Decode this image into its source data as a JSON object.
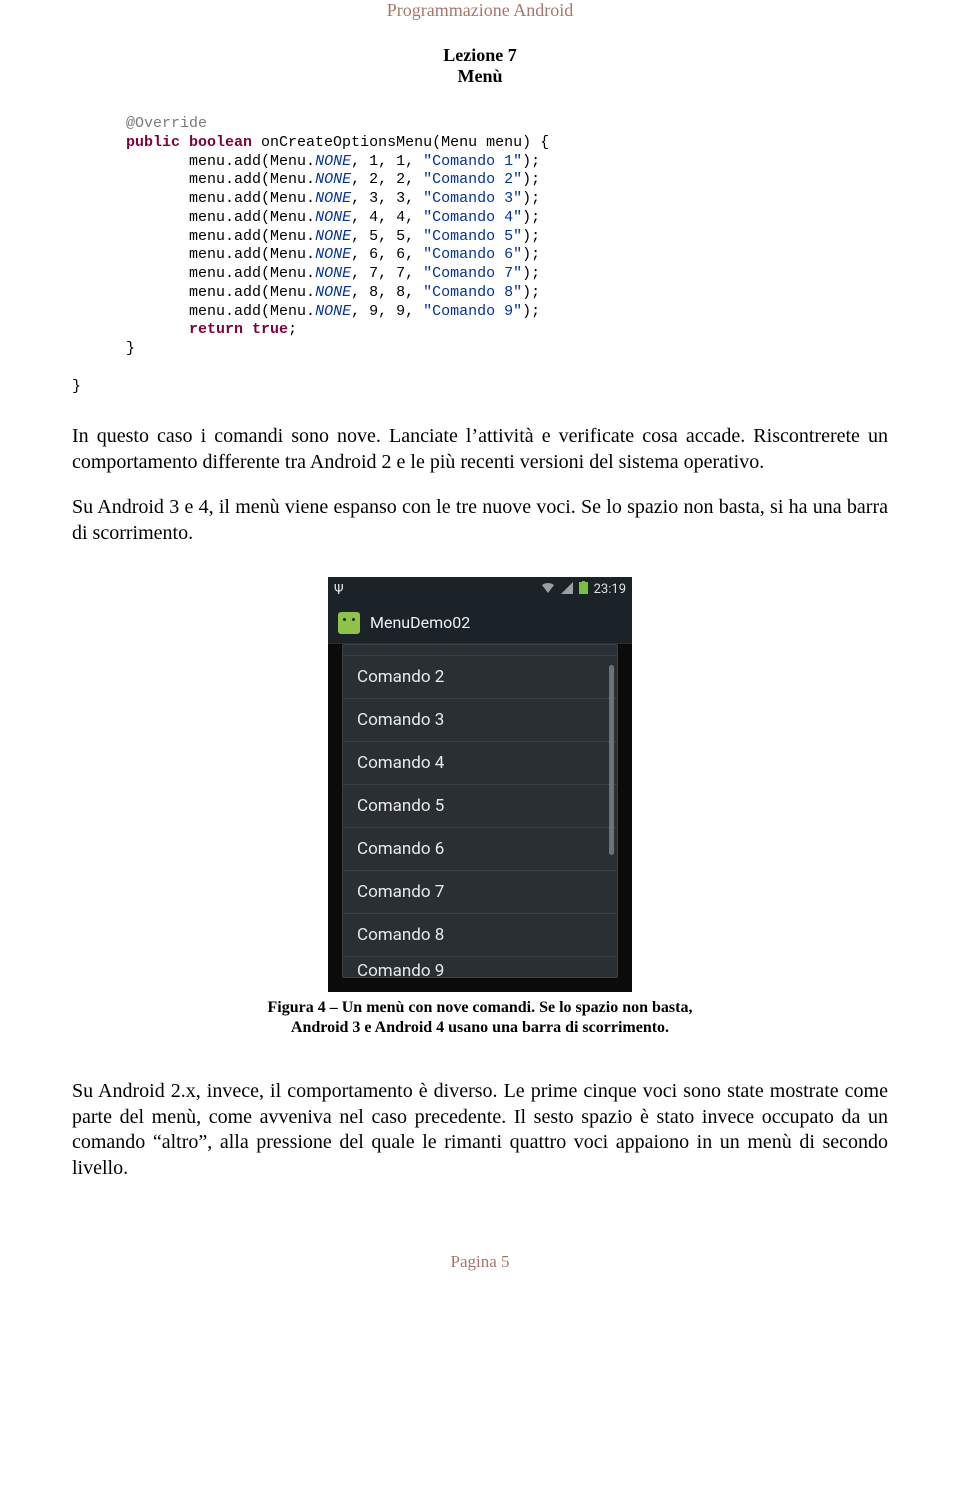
{
  "header": {
    "course": "Programmazione Android",
    "lesson": "Lezione 7",
    "topic": "Menù"
  },
  "code": {
    "annotation": "@Override",
    "signature_prefix": "public boolean",
    "signature_rest": " onCreateOptionsMenu(Menu menu) {",
    "lines": [
      {
        "prefix": "menu.add(Menu.",
        "field": "NONE",
        "mid": ", 1, 1, ",
        "str": "\"Comando 1\"",
        "suffix": ");"
      },
      {
        "prefix": "menu.add(Menu.",
        "field": "NONE",
        "mid": ", 2, 2, ",
        "str": "\"Comando 2\"",
        "suffix": ");"
      },
      {
        "prefix": "menu.add(Menu.",
        "field": "NONE",
        "mid": ", 3, 3, ",
        "str": "\"Comando 3\"",
        "suffix": ");"
      },
      {
        "prefix": "menu.add(Menu.",
        "field": "NONE",
        "mid": ", 4, 4, ",
        "str": "\"Comando 4\"",
        "suffix": ");"
      },
      {
        "prefix": "menu.add(Menu.",
        "field": "NONE",
        "mid": ", 5, 5, ",
        "str": "\"Comando 5\"",
        "suffix": ");"
      },
      {
        "prefix": "menu.add(Menu.",
        "field": "NONE",
        "mid": ", 6, 6, ",
        "str": "\"Comando 6\"",
        "suffix": ");"
      },
      {
        "prefix": "menu.add(Menu.",
        "field": "NONE",
        "mid": ", 7, 7, ",
        "str": "\"Comando 7\"",
        "suffix": ");"
      },
      {
        "prefix": "menu.add(Menu.",
        "field": "NONE",
        "mid": ", 8, 8, ",
        "str": "\"Comando 8\"",
        "suffix": ");"
      },
      {
        "prefix": "menu.add(Menu.",
        "field": "NONE",
        "mid": ", 9, 9, ",
        "str": "\"Comando 9\"",
        "suffix": ");"
      }
    ],
    "ret_kw": "return true",
    "ret_suffix": ";",
    "close1": "}",
    "close2": "}"
  },
  "paragraphs": {
    "p1": "In questo caso i comandi sono nove. Lanciate l’attività e verificate cosa accade. Riscontrerete un comportamento differente tra Android 2 e le più recenti versioni del sistema operativo.",
    "p2": "Su Android 3 e 4, il menù viene espanso con le tre nuove voci. Se lo spazio non basta, si ha una barra di scorrimento.",
    "p3": "Su Android 2.x, invece, il comportamento è diverso. Le prime cinque voci sono state mostrate come parte del menù, come avveniva nel caso precedente. Il sesto spazio è stato invece occupato da un comando “altro”, alla pressione del quale le rimanti quattro voci appaiono in un menù di secondo livello."
  },
  "figure": {
    "status_time": "23:19",
    "app_title": "MenuDemo02",
    "menu_items": [
      "Comando 2",
      "Comando 3",
      "Comando 4",
      "Comando 5",
      "Comando 6",
      "Comando 7",
      "Comando 8",
      "Comando 9"
    ],
    "caption_l1": "Figura 4 – Un menù con nove comandi. Se lo spazio non basta,",
    "caption_l2": "Android 3 e Android 4 usano una barra di scorrimento."
  },
  "footer": {
    "page": "Pagina 5"
  }
}
